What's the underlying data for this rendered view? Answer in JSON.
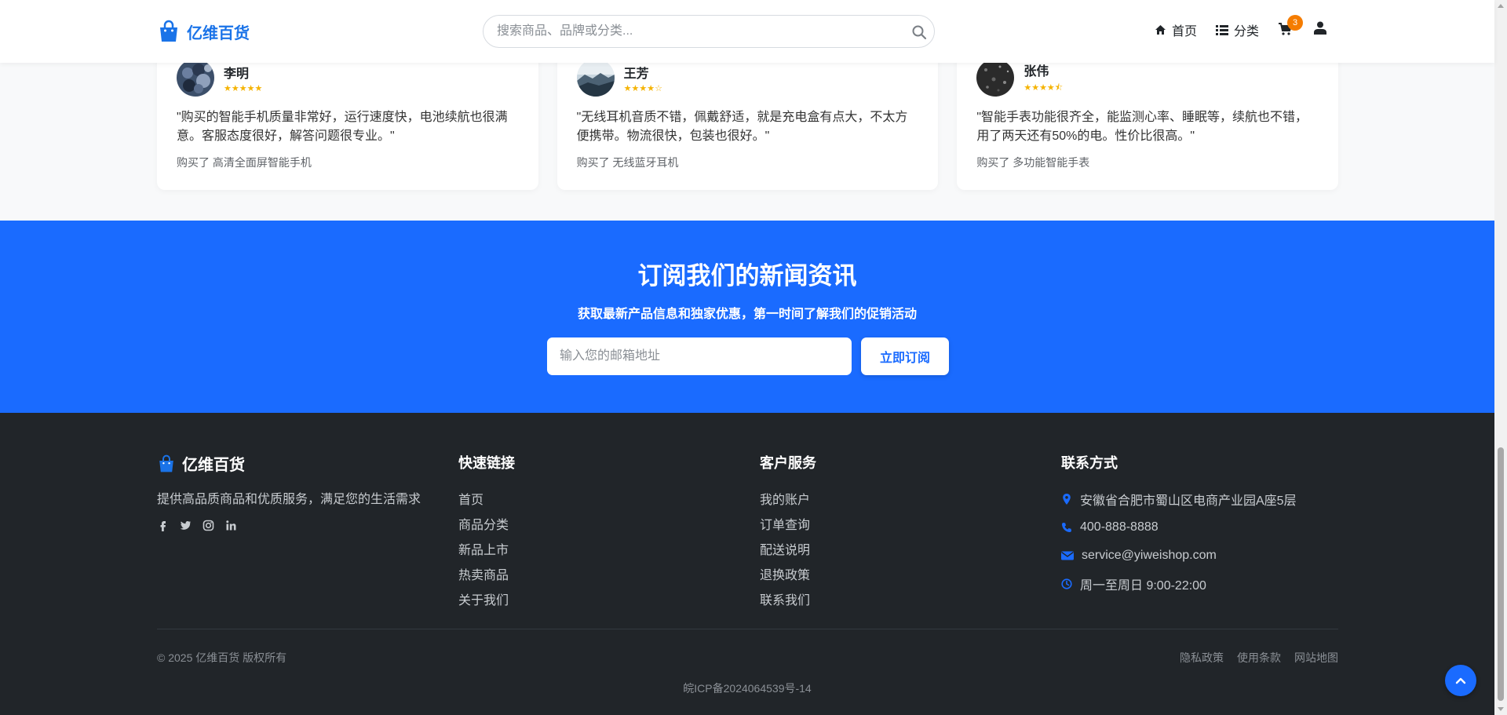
{
  "header": {
    "logo_text": "亿维百货",
    "search_placeholder": "搜索商品、品牌或分类...",
    "nav": [
      {
        "label": "首页",
        "icon": "home-icon"
      },
      {
        "label": "分类",
        "icon": "list-icon"
      }
    ],
    "cart_count": "3"
  },
  "reviews": [
    {
      "name": "李明",
      "stars": "★★★★★",
      "rating": 5,
      "text": "\"购买的智能手机质量非常好，运行速度快，电池续航也很满意。客服态度很好，解答问题很专业。\"",
      "bought": "购买了 高清全面屏智能手机"
    },
    {
      "name": "王芳",
      "stars": "★★★★☆",
      "rating": 4,
      "text": "\"无线耳机音质不错，佩戴舒适，就是充电盒有点大，不太方便携带。物流很快，包装也很好。\"",
      "bought": "购买了 无线蓝牙耳机"
    },
    {
      "name": "张伟",
      "stars": "★★★★⯪",
      "rating": 4.5,
      "text": "\"智能手表功能很齐全，能监测心率、睡眠等，续航也不错，用了两天还有50%的电。性价比很高。\"",
      "bought": "购买了 多功能智能手表"
    }
  ],
  "newsletter": {
    "title": "订阅我们的新闻资讯",
    "subtitle": "获取最新产品信息和独家优惠，第一时间了解我们的促销活动",
    "email_placeholder": "输入您的邮箱地址",
    "button": "立即订阅"
  },
  "footer": {
    "brand": "亿维百货",
    "description": "提供高品质商品和优质服务，满足您的生活需求",
    "socials": [
      "facebook-icon",
      "twitter-icon",
      "instagram-icon",
      "linkedin-icon"
    ],
    "quick_links": {
      "title": "快速链接",
      "items": [
        "首页",
        "商品分类",
        "新品上市",
        "热卖商品",
        "关于我们"
      ]
    },
    "customer_service": {
      "title": "客户服务",
      "items": [
        "我的账户",
        "订单查询",
        "配送说明",
        "退换政策",
        "联系我们"
      ]
    },
    "contact": {
      "title": "联系方式",
      "address": "安徽省合肥市蜀山区电商产业园A座5层",
      "phone": "400-888-8888",
      "email": "service@yiweishop.com",
      "hours": "周一至周日 9:00-22:00"
    },
    "copyright": "© 2025 亿维百货 版权所有",
    "bottom_links": [
      "隐私政策",
      "使用条款",
      "网站地图"
    ],
    "icp": "皖ICP备2024064539号-14"
  },
  "colors": {
    "primary": "#1a6bff",
    "footer_bg": "#212529",
    "badge": "#f57c00",
    "star": "#f5b301"
  }
}
